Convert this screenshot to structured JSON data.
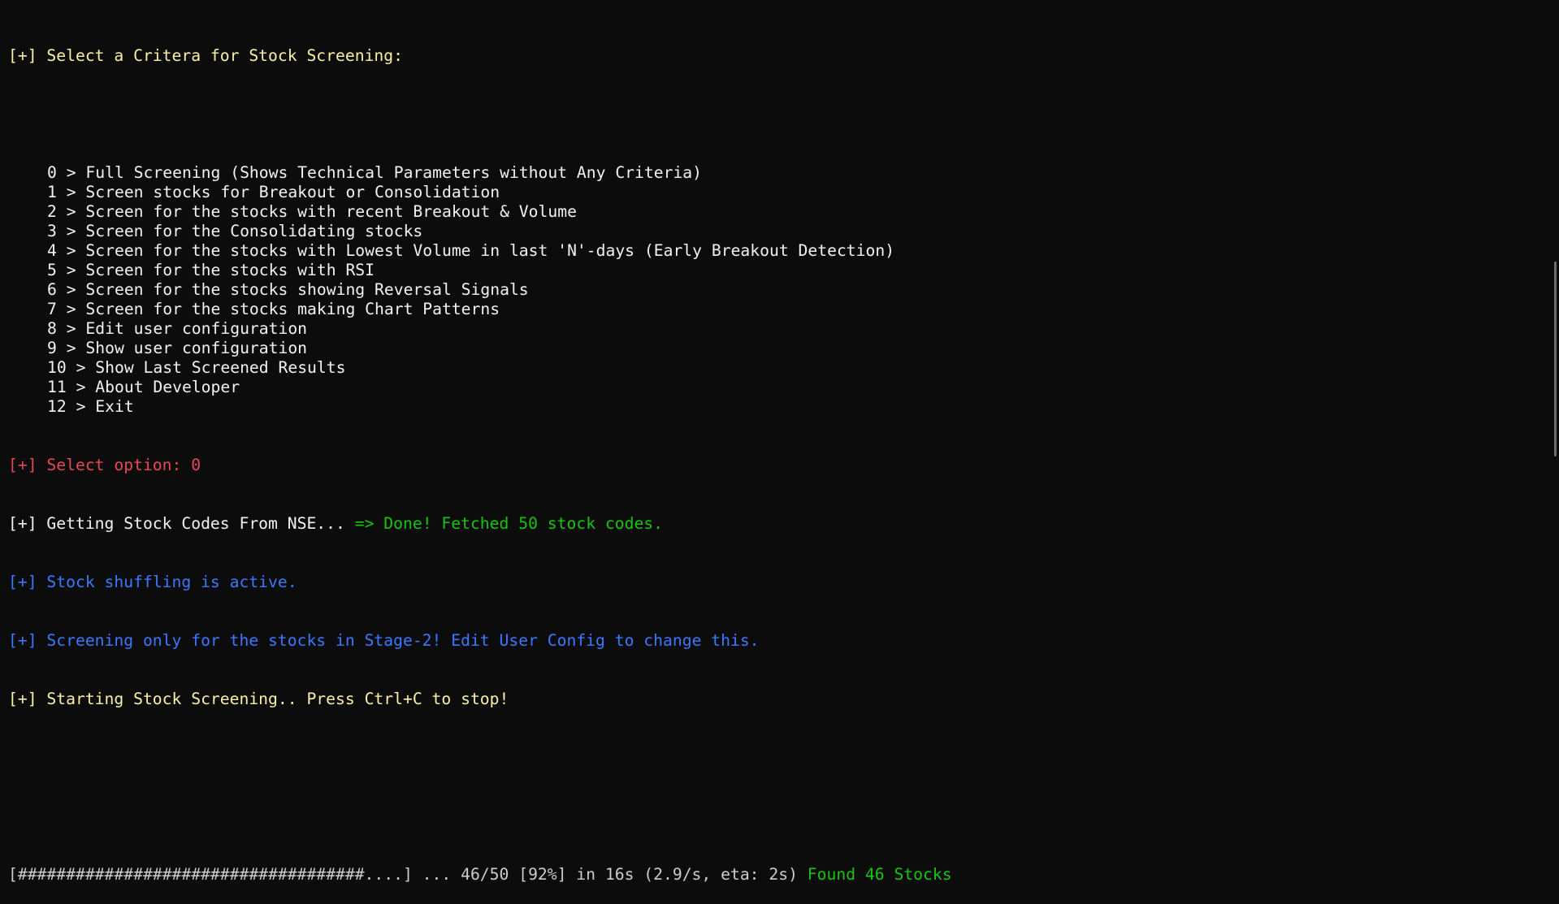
{
  "colors": {
    "background": "#0c0c0c",
    "yellow": "#f9f1a5",
    "red": "#e74856",
    "blue": "#3b78ff",
    "green": "#16c60c",
    "white": "#f2f2f2",
    "grey": "#cccccc"
  },
  "header": {
    "prefix": "[+]",
    "title": "Select a Critera for Stock Screening:"
  },
  "menu": {
    "items": [
      {
        "key": "0",
        "sep": " > ",
        "label": "Full Screening (Shows Technical Parameters without Any Criteria)"
      },
      {
        "key": "1",
        "sep": " > ",
        "label": "Screen stocks for Breakout or Consolidation"
      },
      {
        "key": "2",
        "sep": " > ",
        "label": "Screen for the stocks with recent Breakout & Volume"
      },
      {
        "key": "3",
        "sep": " > ",
        "label": "Screen for the Consolidating stocks"
      },
      {
        "key": "4",
        "sep": " > ",
        "label": "Screen for the stocks with Lowest Volume in last 'N'-days (Early Breakout Detection)"
      },
      {
        "key": "5",
        "sep": " > ",
        "label": "Screen for the stocks with RSI"
      },
      {
        "key": "6",
        "sep": " > ",
        "label": "Screen for the stocks showing Reversal Signals"
      },
      {
        "key": "7",
        "sep": " > ",
        "label": "Screen for the stocks making Chart Patterns"
      },
      {
        "key": "8",
        "sep": " > ",
        "label": "Edit user configuration"
      },
      {
        "key": "9",
        "sep": " > ",
        "label": "Show user configuration"
      },
      {
        "key": "10",
        "sep": " > ",
        "label": "Show Last Screened Results"
      },
      {
        "key": "11",
        "sep": " > ",
        "label": "About Developer"
      },
      {
        "key": "12",
        "sep": " > ",
        "label": "Exit"
      }
    ]
  },
  "log": {
    "select_option": {
      "prefix": "[+]",
      "text": "Select option: 0"
    },
    "fetching": {
      "prefix": "[+]",
      "text": "Getting Stock Codes From NSE... ",
      "result": "=> Done! Fetched 50 stock codes."
    },
    "shuffling": {
      "prefix": "[+]",
      "text": "Stock shuffling is active."
    },
    "stage2": {
      "prefix": "[+]",
      "text": "Screening only for the stocks in Stage-2! Edit User Config to change this."
    },
    "starting": {
      "prefix": "[+]",
      "text": "Starting Stock Screening.. Press Ctrl+C to stop!"
    }
  },
  "progress": {
    "bar": "[####################################....]",
    "stats": " ... 46/50 [92%] in 16s (2.9/s, eta: 2s) ",
    "done": 46,
    "total": 50,
    "percent": 92,
    "elapsed": "16s",
    "rate": "2.9/s",
    "eta": "2s",
    "found": "Found 46 Stocks"
  }
}
